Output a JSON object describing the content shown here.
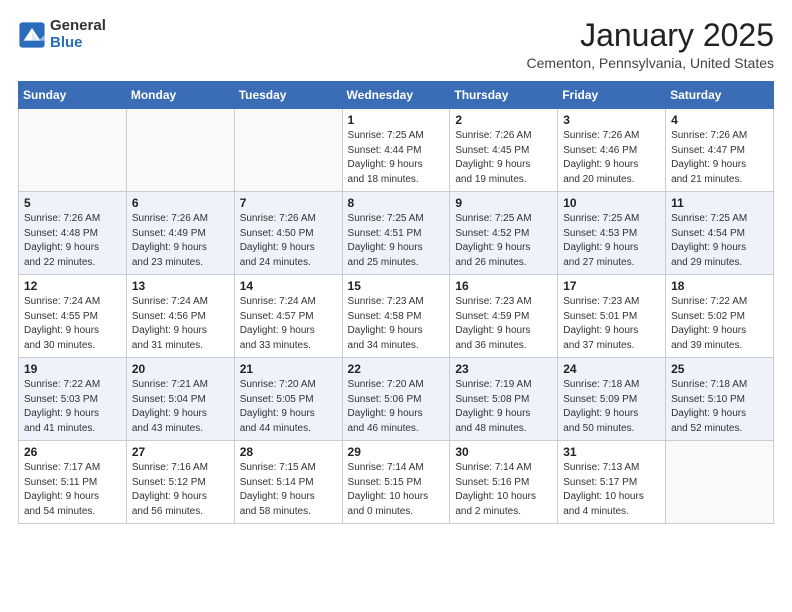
{
  "header": {
    "logo_general": "General",
    "logo_blue": "Blue",
    "month_title": "January 2025",
    "location": "Cementon, Pennsylvania, United States"
  },
  "weekdays": [
    "Sunday",
    "Monday",
    "Tuesday",
    "Wednesday",
    "Thursday",
    "Friday",
    "Saturday"
  ],
  "weeks": [
    [
      {
        "day": "",
        "info": ""
      },
      {
        "day": "",
        "info": ""
      },
      {
        "day": "",
        "info": ""
      },
      {
        "day": "1",
        "info": "Sunrise: 7:25 AM\nSunset: 4:44 PM\nDaylight: 9 hours\nand 18 minutes."
      },
      {
        "day": "2",
        "info": "Sunrise: 7:26 AM\nSunset: 4:45 PM\nDaylight: 9 hours\nand 19 minutes."
      },
      {
        "day": "3",
        "info": "Sunrise: 7:26 AM\nSunset: 4:46 PM\nDaylight: 9 hours\nand 20 minutes."
      },
      {
        "day": "4",
        "info": "Sunrise: 7:26 AM\nSunset: 4:47 PM\nDaylight: 9 hours\nand 21 minutes."
      }
    ],
    [
      {
        "day": "5",
        "info": "Sunrise: 7:26 AM\nSunset: 4:48 PM\nDaylight: 9 hours\nand 22 minutes."
      },
      {
        "day": "6",
        "info": "Sunrise: 7:26 AM\nSunset: 4:49 PM\nDaylight: 9 hours\nand 23 minutes."
      },
      {
        "day": "7",
        "info": "Sunrise: 7:26 AM\nSunset: 4:50 PM\nDaylight: 9 hours\nand 24 minutes."
      },
      {
        "day": "8",
        "info": "Sunrise: 7:25 AM\nSunset: 4:51 PM\nDaylight: 9 hours\nand 25 minutes."
      },
      {
        "day": "9",
        "info": "Sunrise: 7:25 AM\nSunset: 4:52 PM\nDaylight: 9 hours\nand 26 minutes."
      },
      {
        "day": "10",
        "info": "Sunrise: 7:25 AM\nSunset: 4:53 PM\nDaylight: 9 hours\nand 27 minutes."
      },
      {
        "day": "11",
        "info": "Sunrise: 7:25 AM\nSunset: 4:54 PM\nDaylight: 9 hours\nand 29 minutes."
      }
    ],
    [
      {
        "day": "12",
        "info": "Sunrise: 7:24 AM\nSunset: 4:55 PM\nDaylight: 9 hours\nand 30 minutes."
      },
      {
        "day": "13",
        "info": "Sunrise: 7:24 AM\nSunset: 4:56 PM\nDaylight: 9 hours\nand 31 minutes."
      },
      {
        "day": "14",
        "info": "Sunrise: 7:24 AM\nSunset: 4:57 PM\nDaylight: 9 hours\nand 33 minutes."
      },
      {
        "day": "15",
        "info": "Sunrise: 7:23 AM\nSunset: 4:58 PM\nDaylight: 9 hours\nand 34 minutes."
      },
      {
        "day": "16",
        "info": "Sunrise: 7:23 AM\nSunset: 4:59 PM\nDaylight: 9 hours\nand 36 minutes."
      },
      {
        "day": "17",
        "info": "Sunrise: 7:23 AM\nSunset: 5:01 PM\nDaylight: 9 hours\nand 37 minutes."
      },
      {
        "day": "18",
        "info": "Sunrise: 7:22 AM\nSunset: 5:02 PM\nDaylight: 9 hours\nand 39 minutes."
      }
    ],
    [
      {
        "day": "19",
        "info": "Sunrise: 7:22 AM\nSunset: 5:03 PM\nDaylight: 9 hours\nand 41 minutes."
      },
      {
        "day": "20",
        "info": "Sunrise: 7:21 AM\nSunset: 5:04 PM\nDaylight: 9 hours\nand 43 minutes."
      },
      {
        "day": "21",
        "info": "Sunrise: 7:20 AM\nSunset: 5:05 PM\nDaylight: 9 hours\nand 44 minutes."
      },
      {
        "day": "22",
        "info": "Sunrise: 7:20 AM\nSunset: 5:06 PM\nDaylight: 9 hours\nand 46 minutes."
      },
      {
        "day": "23",
        "info": "Sunrise: 7:19 AM\nSunset: 5:08 PM\nDaylight: 9 hours\nand 48 minutes."
      },
      {
        "day": "24",
        "info": "Sunrise: 7:18 AM\nSunset: 5:09 PM\nDaylight: 9 hours\nand 50 minutes."
      },
      {
        "day": "25",
        "info": "Sunrise: 7:18 AM\nSunset: 5:10 PM\nDaylight: 9 hours\nand 52 minutes."
      }
    ],
    [
      {
        "day": "26",
        "info": "Sunrise: 7:17 AM\nSunset: 5:11 PM\nDaylight: 9 hours\nand 54 minutes."
      },
      {
        "day": "27",
        "info": "Sunrise: 7:16 AM\nSunset: 5:12 PM\nDaylight: 9 hours\nand 56 minutes."
      },
      {
        "day": "28",
        "info": "Sunrise: 7:15 AM\nSunset: 5:14 PM\nDaylight: 9 hours\nand 58 minutes."
      },
      {
        "day": "29",
        "info": "Sunrise: 7:14 AM\nSunset: 5:15 PM\nDaylight: 10 hours\nand 0 minutes."
      },
      {
        "day": "30",
        "info": "Sunrise: 7:14 AM\nSunset: 5:16 PM\nDaylight: 10 hours\nand 2 minutes."
      },
      {
        "day": "31",
        "info": "Sunrise: 7:13 AM\nSunset: 5:17 PM\nDaylight: 10 hours\nand 4 minutes."
      },
      {
        "day": "",
        "info": ""
      }
    ]
  ]
}
